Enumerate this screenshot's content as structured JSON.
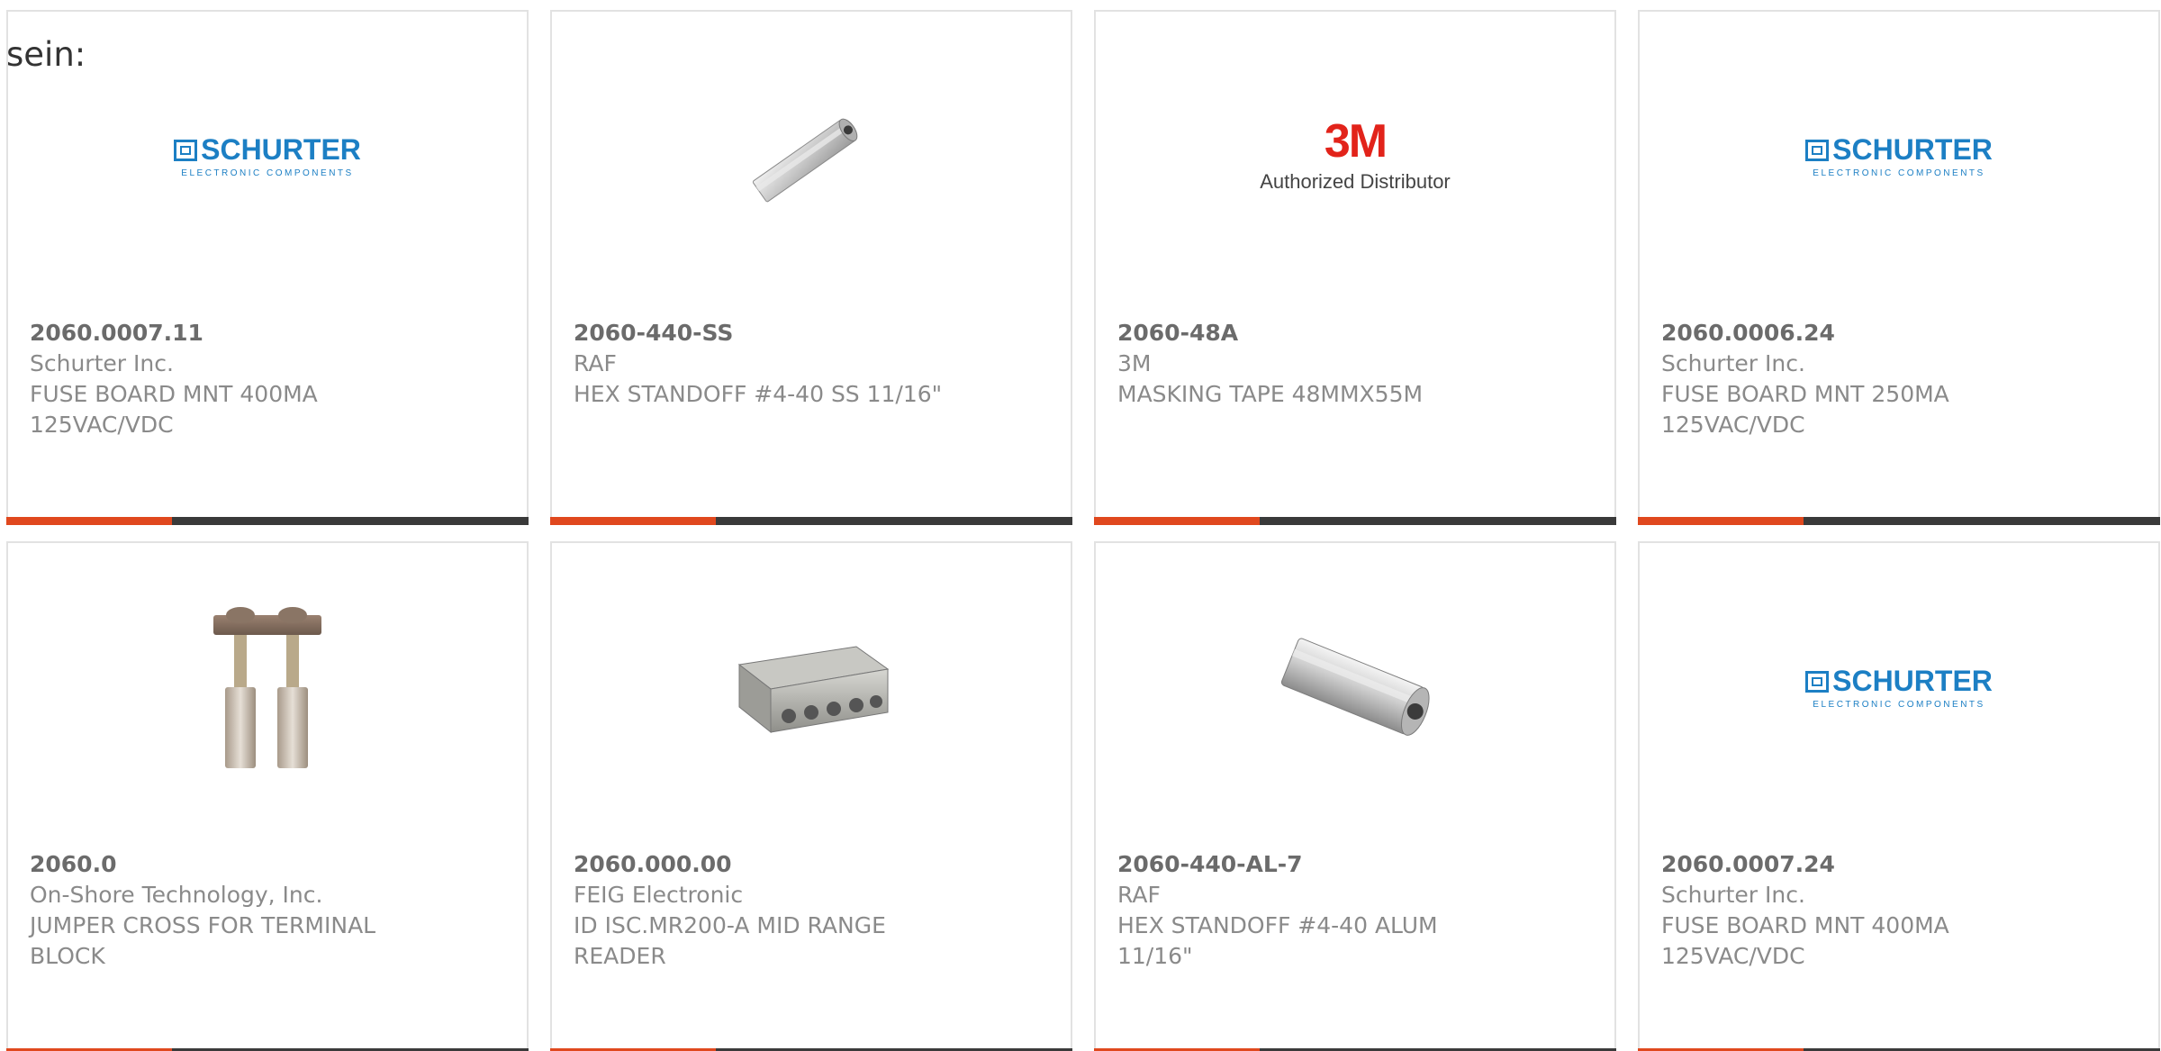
{
  "stray_text": "sein:",
  "colors": {
    "accent_bar": "#e0481e",
    "dark_bar": "#3a3a3a",
    "brand_blue": "#1c7fc4",
    "brand_red": "#e2231a"
  },
  "products": [
    {
      "part_number": "2060.0007.11",
      "manufacturer": "Schurter Inc.",
      "description": "FUSE BOARD MNT 400MA 125VAC/VDC",
      "image": "schurter-logo",
      "logo_text": "SCHURTER",
      "logo_sub": "ELECTRONIC COMPONENTS"
    },
    {
      "part_number": "2060-440-SS",
      "manufacturer": "RAF",
      "description": "HEX STANDOFF #4-40 SS 11/16\"",
      "image": "standoff-photo"
    },
    {
      "part_number": "2060-48A",
      "manufacturer": "3M",
      "description": "MASKING TAPE 48MMX55M",
      "image": "3m-logo",
      "logo_text": "3M",
      "logo_sub": "Authorized Distributor"
    },
    {
      "part_number": "2060.0006.24",
      "manufacturer": "Schurter Inc.",
      "description": "FUSE BOARD MNT 250MA 125VAC/VDC",
      "image": "schurter-logo",
      "logo_text": "SCHURTER",
      "logo_sub": "ELECTRONIC COMPONENTS"
    },
    {
      "part_number": "2060.0",
      "manufacturer": "On-Shore Technology, Inc.",
      "description": "JUMPER CROSS FOR TERMINAL BLOCK",
      "image": "jumper-photo"
    },
    {
      "part_number": "2060.000.00",
      "manufacturer": "FEIG Electronic",
      "description": "ID ISC.MR200-A MID RANGE READER",
      "image": "reader-box-photo"
    },
    {
      "part_number": "2060-440-AL-7",
      "manufacturer": "RAF",
      "description": "HEX STANDOFF #4-40 ALUM 11/16\"",
      "image": "standoff-photo"
    },
    {
      "part_number": "2060.0007.24",
      "manufacturer": "Schurter Inc.",
      "description": "FUSE BOARD MNT 400MA 125VAC/VDC",
      "image": "schurter-logo",
      "logo_text": "SCHURTER",
      "logo_sub": "ELECTRONIC COMPONENTS"
    }
  ]
}
